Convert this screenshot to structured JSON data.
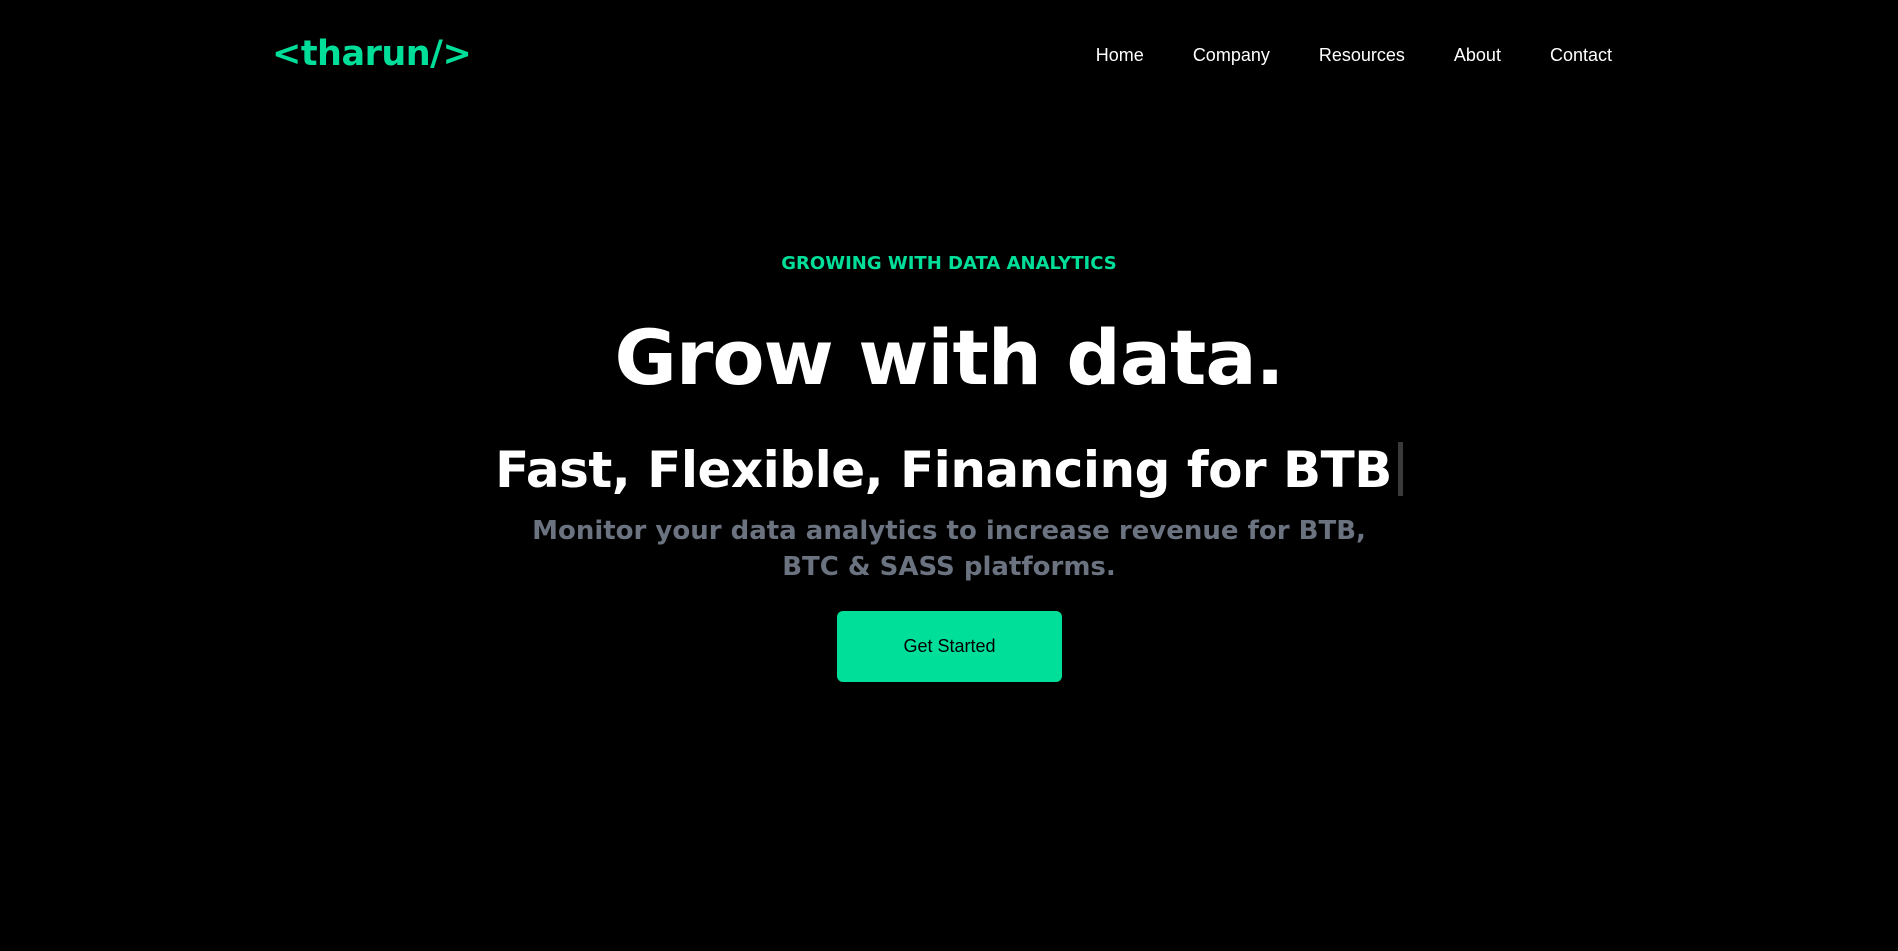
{
  "colors": {
    "background": "#000000",
    "accent": "#00df9a",
    "text": "#ffffff",
    "muted": "#6b7280"
  },
  "header": {
    "logo": "<tharun/>",
    "nav": [
      "Home",
      "Company",
      "Resources",
      "About",
      "Contact"
    ]
  },
  "hero": {
    "eyebrow": "GROWING WITH DATA ANALYTICS",
    "headline": "Grow with data.",
    "typed_prefix": "Fast, Flexible, Financing for",
    "typed_word": "BTB",
    "subtext": "Monitor your data analytics to increase revenue for BTB, BTC & SASS platforms.",
    "cta_label": "Get Started"
  }
}
